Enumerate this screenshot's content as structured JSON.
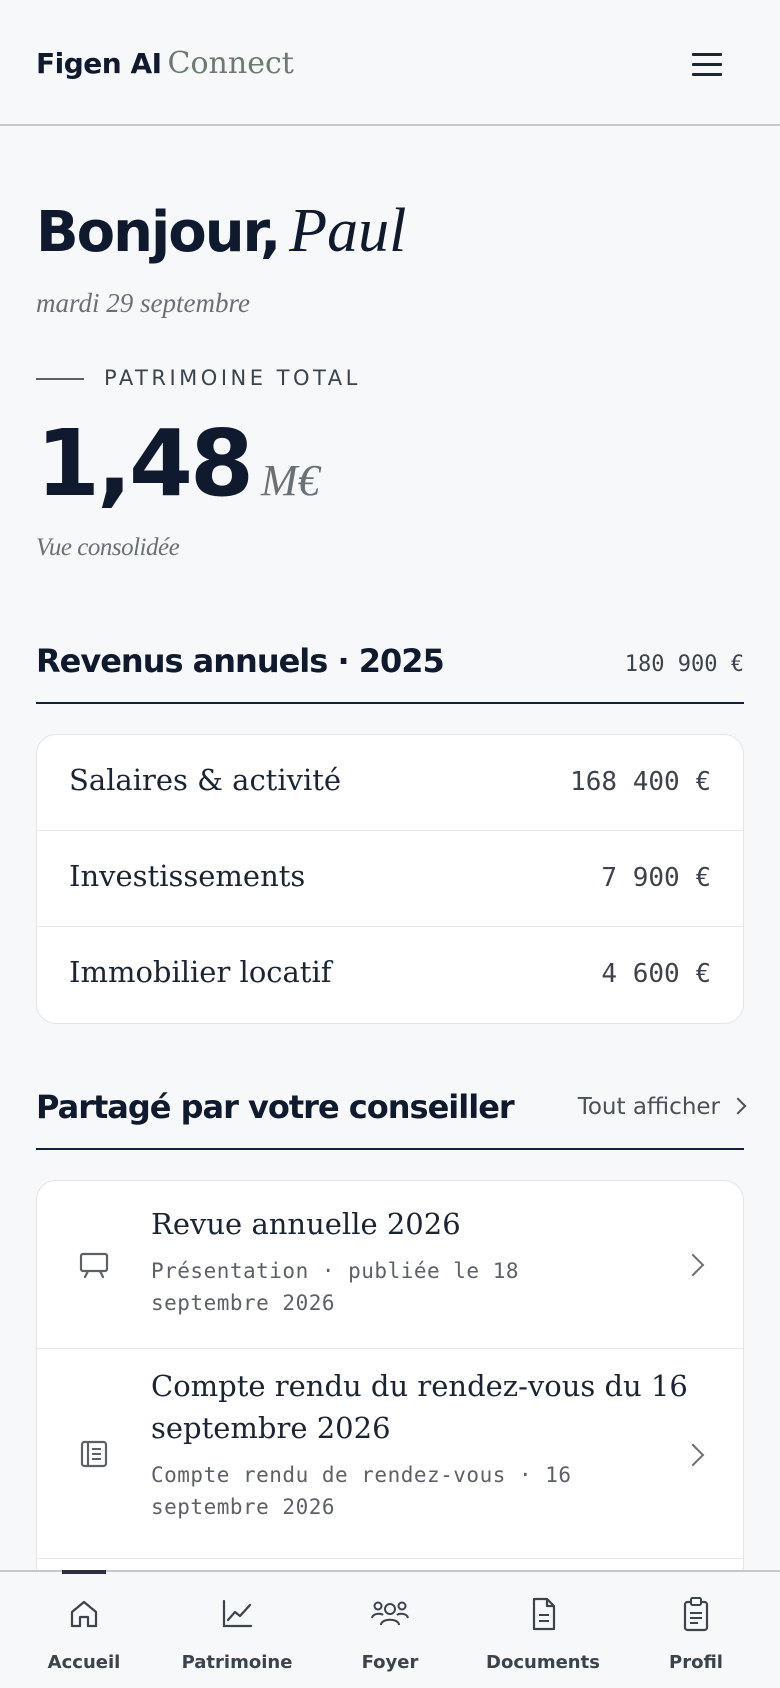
{
  "header": {
    "brand_strong": "Figen AI",
    "brand_light": "Connect",
    "menu_icon": "hamburger-menu-icon"
  },
  "greeting": {
    "hello": "Bonjour,",
    "name": "Paul",
    "date": "mardi 29 septembre"
  },
  "wealth": {
    "label": "PATRIMOINE TOTAL",
    "value": "1,48",
    "unit": "M€",
    "subtitle": "Vue consolidée"
  },
  "income": {
    "title": "Revenus annuels · 2025",
    "total": "180 900 €",
    "items": [
      {
        "label": "Salaires & activité",
        "value": "168 400 €"
      },
      {
        "label": "Investissements",
        "value": "7 900 €"
      },
      {
        "label": "Immobilier locatif",
        "value": "4 600 €"
      }
    ]
  },
  "shared": {
    "title": "Partagé par votre conseiller",
    "see_all": "Tout afficher",
    "items": [
      {
        "title": "Revue annuelle 2026",
        "meta": "Présentation · publiée le 18 septembre 2026",
        "icon": "presentation-icon"
      },
      {
        "title": "Compte rendu du rendez-vous du 16 septembre 2026",
        "meta": "Compte rendu de rendez-vous · 16 septembre 2026",
        "icon": "report-icon"
      }
    ]
  },
  "nav": {
    "items": [
      {
        "label": "Accueil",
        "icon": "home-icon",
        "active": true
      },
      {
        "label": "Patrimoine",
        "icon": "chart-line-icon"
      },
      {
        "label": "Foyer",
        "icon": "people-icon"
      },
      {
        "label": "Documents",
        "icon": "document-icon"
      },
      {
        "label": "Profil",
        "icon": "clipboard-icon"
      }
    ]
  },
  "colors": {
    "ink": "#0f1a2e",
    "muted": "#6b7076",
    "brand_accent": "#6d7a6f",
    "background": "#f7f8f9",
    "card": "#ffffff"
  }
}
